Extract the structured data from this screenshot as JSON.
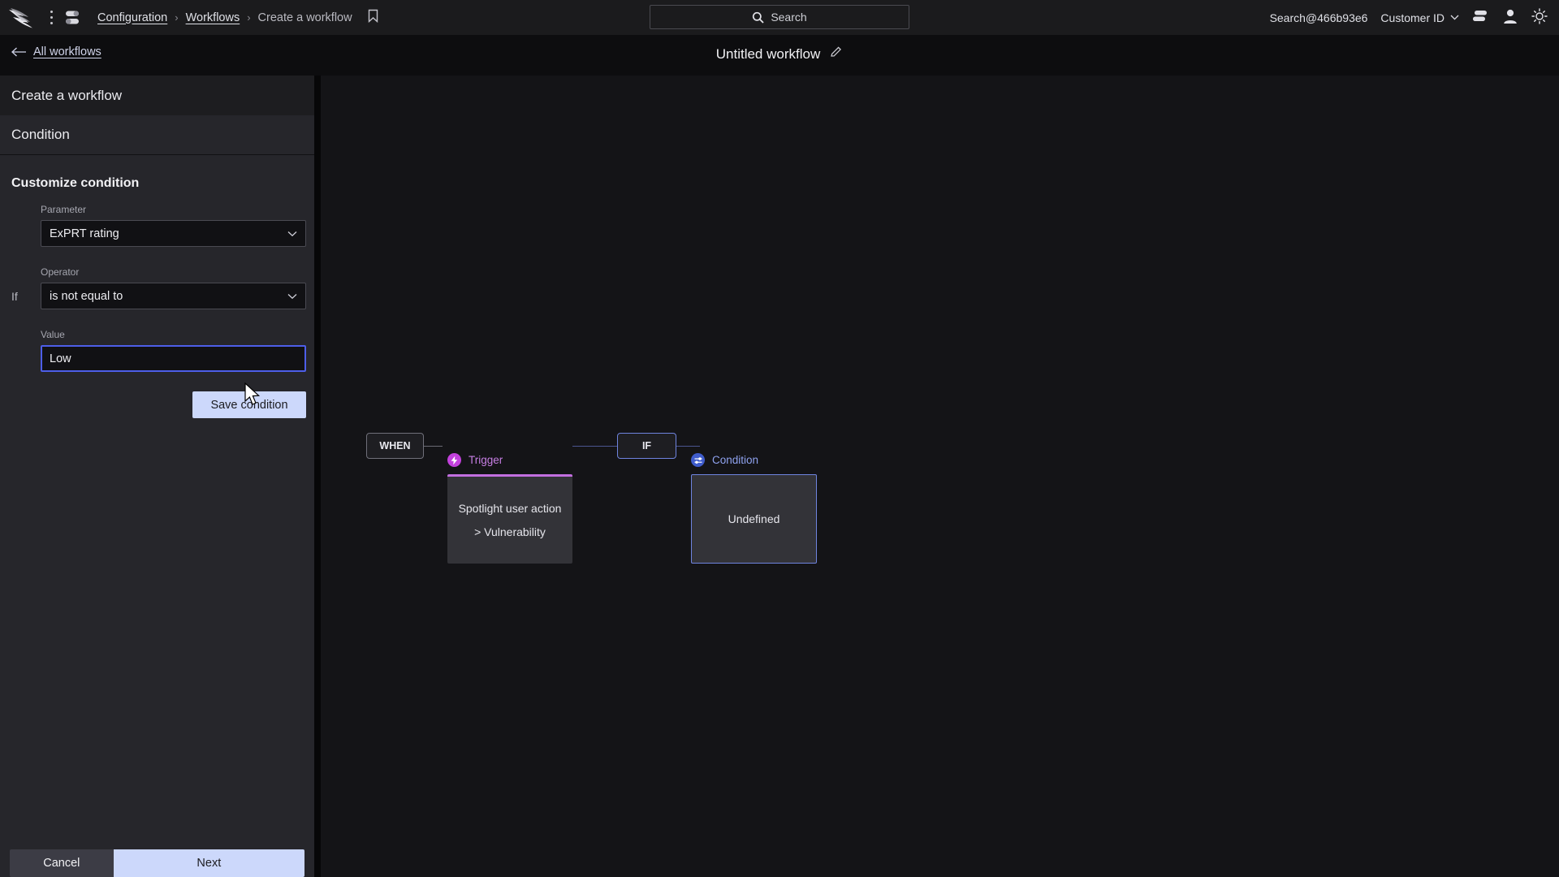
{
  "topbar": {
    "logo_icon": "crowdstrike-falcon-logo",
    "menu_icon": "kebab-menu-icon",
    "apps_icon": "apps-grid-icon",
    "breadcrumb": [
      {
        "label": "Configuration",
        "link": true
      },
      {
        "label": "Workflows",
        "link": true
      },
      {
        "label": "Create a workflow",
        "link": false
      }
    ],
    "separator": "›",
    "bookmark_icon": "bookmark-icon",
    "search": {
      "icon": "search-icon",
      "placeholder": "Search",
      "value": ""
    },
    "account": "Search@466b93e6",
    "customer_id_label": "Customer ID",
    "customer_chevron_icon": "chevron-down-icon",
    "list_icon": "stacked-list-icon",
    "user_icon": "user-avatar-icon",
    "theme_icon": "brightness-sun-icon"
  },
  "subheader": {
    "back_icon": "arrow-left-icon",
    "back_label": "All workflows",
    "workflow_title": "Untitled workflow",
    "edit_icon": "pencil-edit-icon"
  },
  "panel": {
    "header": "Create a workflow",
    "step": "Condition",
    "section_title": "Customize condition",
    "if_label": "If",
    "fields": [
      {
        "label": "Parameter",
        "value": "ExPRT rating",
        "type": "select",
        "chevron": "chevron-down-icon"
      },
      {
        "label": "Operator",
        "value": "is not equal to",
        "type": "select",
        "chevron": "chevron-down-icon"
      },
      {
        "label": "Value",
        "value": "Low",
        "type": "text",
        "focused": true
      }
    ],
    "save_condition_label": "Save condition",
    "cancel_label": "Cancel",
    "next_label": "Next"
  },
  "canvas": {
    "nodes": [
      {
        "kind": "trigger",
        "badge_icon": "lightning-bolt-icon",
        "badge_label": "Trigger",
        "chip_label": "WHEN",
        "line1": "Spotlight user action",
        "line2": "> Vulnerability",
        "accent_color": "#c36fe0"
      },
      {
        "kind": "condition",
        "badge_icon": "filter-sliders-icon",
        "badge_label": "Condition",
        "chip_label": "IF",
        "line1": "Undefined",
        "line2": "",
        "accent_color": "#6f84df"
      }
    ]
  },
  "colors": {
    "accent_blue": "#4d5ee8",
    "primary_button": "#ccd8fb",
    "trigger_magenta": "#c341dd",
    "condition_blue": "#3f5ccb",
    "canvas_bg": "#141417",
    "panel_bg": "#26262b"
  }
}
